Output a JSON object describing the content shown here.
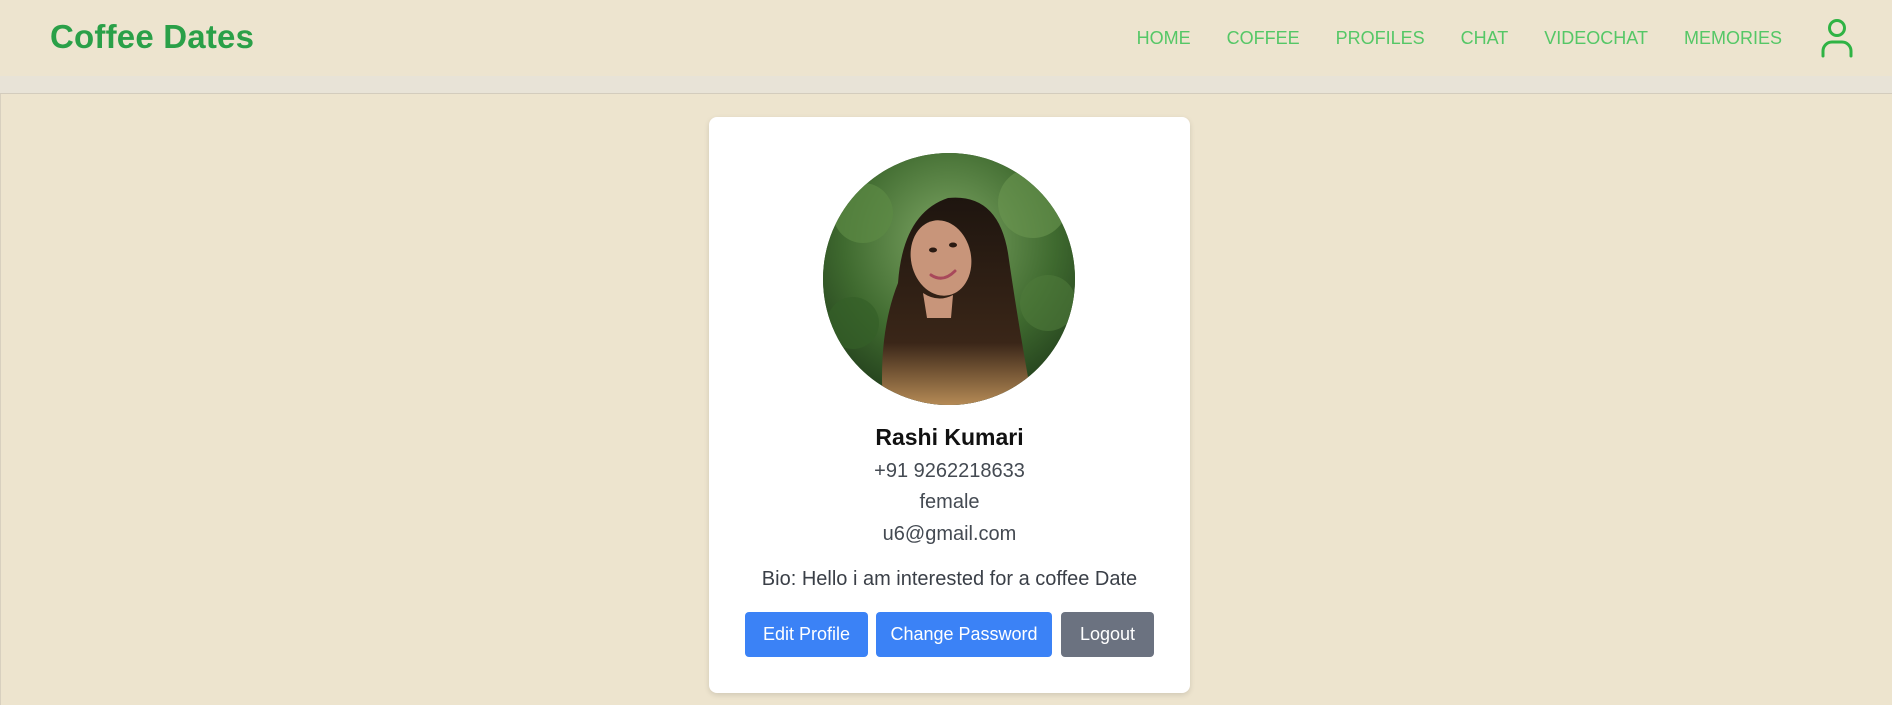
{
  "brand": {
    "title": "Coffee Dates"
  },
  "nav": {
    "items": [
      {
        "label": "HOME"
      },
      {
        "label": "COFFEE"
      },
      {
        "label": "PROFILES"
      },
      {
        "label": "CHAT"
      },
      {
        "label": "VIDEOCHAT"
      },
      {
        "label": "MEMORIES"
      }
    ],
    "user_icon": "user-icon"
  },
  "profile": {
    "name": "Rashi Kumari",
    "phone": "+91 9262218633",
    "gender": "female",
    "email": "u6@gmail.com",
    "bio": "Bio: Hello i am interested for a coffee Date"
  },
  "actions": {
    "edit_label": "Edit Profile",
    "change_password_label": "Change Password",
    "logout_label": "Logout"
  },
  "colors": {
    "brand": "#2aa048",
    "nav_link": "#55c766",
    "background": "#ede4ce",
    "primary_button": "#3b82f6",
    "secondary_button": "#6b7280"
  }
}
